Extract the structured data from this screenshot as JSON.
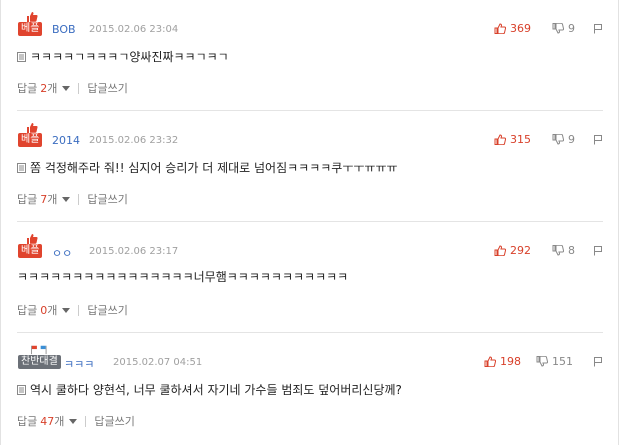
{
  "comments": [
    {
      "badge": "베플",
      "nickname": "BOB",
      "date": "2015.02.06 23:04",
      "likes": "369",
      "dislikes": "9",
      "text": "ㅋㅋㅋㅋㄱㅋㅋㅋㄱ양싸진짜ㅋㅋㄱㅋㄱ",
      "reply_label": "답글",
      "reply_count": "2",
      "reply_unit": "개",
      "write_reply": "답글쓰기"
    },
    {
      "badge": "베플",
      "nickname": "2014",
      "date": "2015.02.06 23:32",
      "likes": "315",
      "dislikes": "9",
      "text": "쫌 걱정해주라 줘!! 심지어 승리가 더 제대로 넘어짐ㅋㅋㅋㅋ쿠ㅜㅜㅠㅠㅠ",
      "reply_label": "답글",
      "reply_count": "7",
      "reply_unit": "개",
      "write_reply": "답글쓰기"
    },
    {
      "badge": "베플",
      "nickname": "ㅇㅇ",
      "date": "2015.02.06 23:17",
      "likes": "292",
      "dislikes": "8",
      "text": "ㅋㅋㅋㅋㅋㅋㅋㅋㅋㅋㅋㅋㅋㅋㅋㅋ너무햄ㅋㅋㅋㅋㅋㅋㅋㅋㅋㅋㅋ",
      "reply_label": "답글",
      "reply_count": "0",
      "reply_unit": "개",
      "write_reply": "답글쓰기"
    },
    {
      "badge": "찬반대결",
      "nickname": "ㅋㅋㅋ",
      "date": "2015.02.07 04:51",
      "likes": "198",
      "dislikes": "151",
      "text": "역시 쿨하다 양현석, 너무 쿨하셔서 자기네 가수들 범죄도 덮어버리신당께?",
      "reply_label": "답글",
      "reply_count": "47",
      "reply_unit": "개",
      "write_reply": "답글쓰기"
    }
  ],
  "colors": {
    "accent": "#e0442e",
    "nickname": "#3b6dc0",
    "muted": "#a0a0a0",
    "badge_gray": "#6b7077"
  },
  "icons": {
    "best": "thumb-up-hand-icon",
    "versus": "flag-icon",
    "like": "thumb-up-icon",
    "dislike": "thumb-down-icon",
    "report": "report-flag-icon",
    "document": "document-icon",
    "caret": "caret-down-icon"
  }
}
